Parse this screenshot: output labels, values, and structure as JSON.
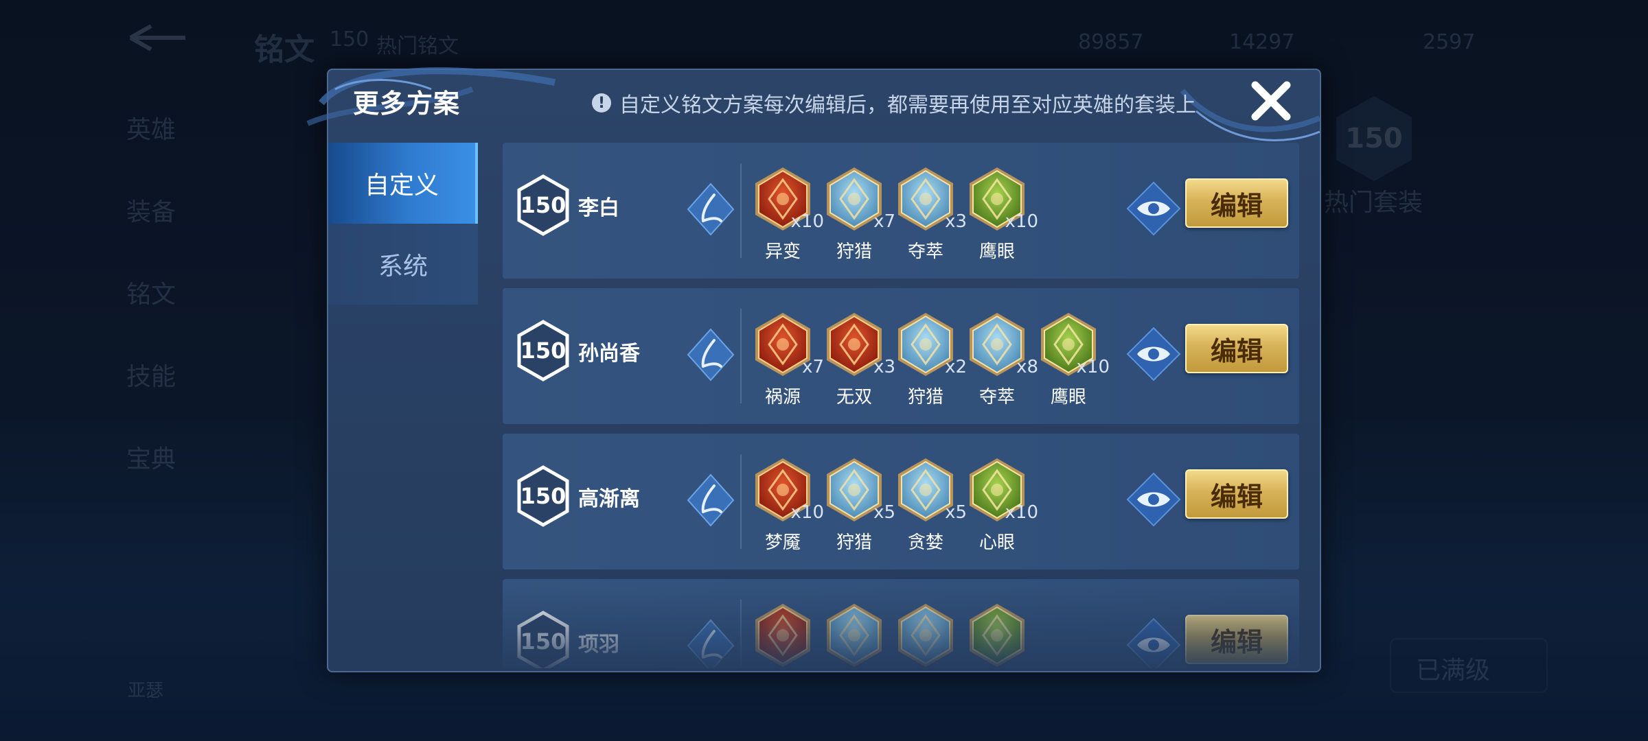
{
  "background": {
    "title": "铭文",
    "header_level": "150",
    "header_sub": "热门铭文",
    "currency_1": "89857",
    "currency_2": "14297",
    "currency_3": "2597",
    "side_items": [
      "英雄",
      "装备",
      "铭文",
      "技能",
      "宝典"
    ],
    "big_level": "150",
    "hot_sets": "热门套装",
    "bottom_btn": "已满级",
    "bottom_left": "亚瑟"
  },
  "modal": {
    "title": "更多方案",
    "notice": "自定义铭文方案每次编辑后，都需要再使用至对应英雄的套装上",
    "tabs": [
      {
        "label": "自定义",
        "active": true
      },
      {
        "label": "系统",
        "active": false
      }
    ],
    "edit_label": "编辑",
    "plans": [
      {
        "level": "150",
        "hero": "李白",
        "runes": [
          {
            "name": "异变",
            "qty": "x10",
            "color": "red",
            "icon": "chaos-rune-icon"
          },
          {
            "name": "狩猎",
            "qty": "x7",
            "color": "blue",
            "icon": "hunt-rune-icon"
          },
          {
            "name": "夺萃",
            "qty": "x3",
            "color": "blue",
            "icon": "trinity-rune-icon"
          },
          {
            "name": "鹰眼",
            "qty": "x10",
            "color": "green",
            "icon": "clover-rune-icon"
          }
        ]
      },
      {
        "level": "150",
        "hero": "孙尚香",
        "runes": [
          {
            "name": "祸源",
            "qty": "x7",
            "color": "red",
            "icon": "flame-rune-icon"
          },
          {
            "name": "无双",
            "qty": "x3",
            "color": "red",
            "icon": "rose-rune-icon"
          },
          {
            "name": "狩猎",
            "qty": "x2",
            "color": "blue",
            "icon": "hunt-rune-icon"
          },
          {
            "name": "夺萃",
            "qty": "x8",
            "color": "blue",
            "icon": "trinity-rune-icon"
          },
          {
            "name": "鹰眼",
            "qty": "x10",
            "color": "green",
            "icon": "clover-rune-icon"
          }
        ]
      },
      {
        "level": "150",
        "hero": "高渐离",
        "runes": [
          {
            "name": "梦魇",
            "qty": "x10",
            "color": "red",
            "icon": "nightmare-rune-icon"
          },
          {
            "name": "狩猎",
            "qty": "x5",
            "color": "blue",
            "icon": "hunt-rune-icon"
          },
          {
            "name": "贪婪",
            "qty": "x5",
            "color": "blue",
            "icon": "star-rune-icon"
          },
          {
            "name": "心眼",
            "qty": "x10",
            "color": "green",
            "icon": "book-rune-icon"
          }
        ]
      },
      {
        "level": "150",
        "hero": "项羽",
        "runes": [
          {
            "name": "",
            "qty": "",
            "color": "red",
            "icon": "moon-rune-icon"
          },
          {
            "name": "",
            "qty": "",
            "color": "blue",
            "icon": "water-rune-icon"
          },
          {
            "name": "",
            "qty": "",
            "color": "blue",
            "icon": "hunt-rune-icon"
          },
          {
            "name": "",
            "qty": "",
            "color": "green",
            "icon": "clover-rune-icon"
          }
        ]
      }
    ]
  },
  "colors": {
    "red_gem": "#c2361c",
    "blue_gem": "#6fb4d8",
    "green_gem": "#7fb43c",
    "edit_gold": "#d8b258",
    "active_tab": "#2f7bd0"
  }
}
